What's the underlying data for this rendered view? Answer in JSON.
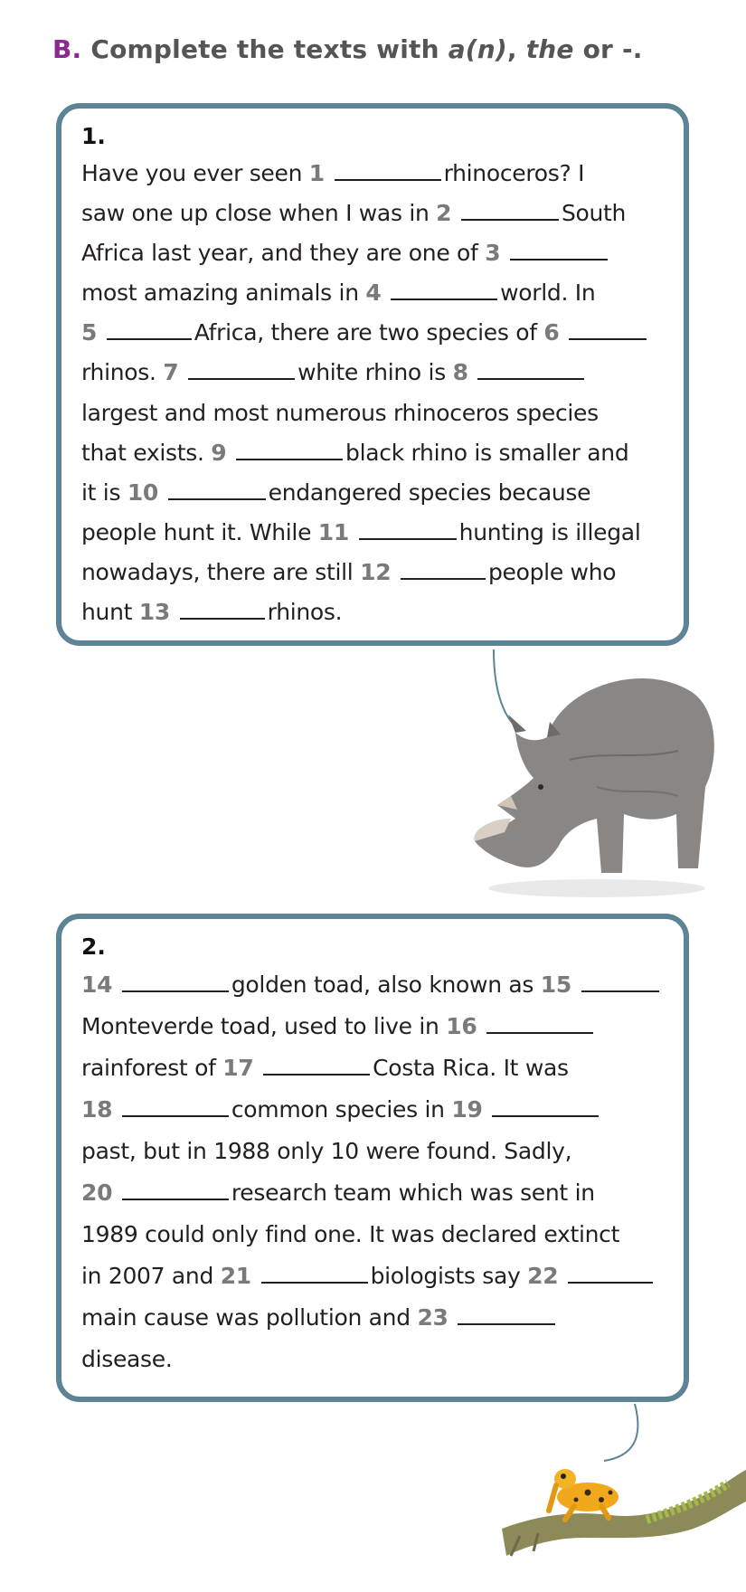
{
  "exercise": {
    "letter": "B.",
    "instruction_pre": "Complete the texts with ",
    "opt1": "a(n)",
    "sep": ", ",
    "opt2": "the",
    "instruction_post": " or -."
  },
  "text1": {
    "number": "1.",
    "lines": [
      [
        {
          "t": "Have you ever seen "
        },
        {
          "n": "1"
        },
        {
          "b": "w90"
        },
        {
          "t": "rhinoceros? I"
        }
      ],
      [
        {
          "t": "saw one up close when I was in "
        },
        {
          "n": "2"
        },
        {
          "b": "w80"
        },
        {
          "t": "South"
        }
      ],
      [
        {
          "t": "Africa last year, and they are one of "
        },
        {
          "n": "3"
        },
        {
          "b": "w80"
        }
      ],
      [
        {
          "t": "most amazing animals in "
        },
        {
          "n": "4"
        },
        {
          "b": "w90"
        },
        {
          "t": "world. In"
        }
      ],
      [
        {
          "n": "5"
        },
        {
          "b": "w70"
        },
        {
          "t": "Africa, there are two species of "
        },
        {
          "n": "6"
        },
        {
          "b": "w60"
        }
      ],
      [
        {
          "t": "rhinos. "
        },
        {
          "n": "7"
        },
        {
          "b": "w90"
        },
        {
          "t": "white rhino is "
        },
        {
          "n": "8"
        },
        {
          "b": "w90"
        }
      ],
      [
        {
          "t": "largest and most numerous rhinoceros species"
        }
      ],
      [
        {
          "t": "that exists. "
        },
        {
          "n": "9"
        },
        {
          "b": "w90"
        },
        {
          "t": "black rhino is smaller and"
        }
      ],
      [
        {
          "t": "it is "
        },
        {
          "n": "10"
        },
        {
          "b": "w80"
        },
        {
          "t": "endangered species because"
        }
      ],
      [
        {
          "t": "people hunt it. While "
        },
        {
          "n": "11"
        },
        {
          "b": "w80"
        },
        {
          "t": "hunting is illegal"
        }
      ],
      [
        {
          "t": "nowadays, there are still "
        },
        {
          "n": "12"
        },
        {
          "b": "w70"
        },
        {
          "t": "people who"
        }
      ],
      [
        {
          "t": "hunt "
        },
        {
          "n": "13"
        },
        {
          "b": "w70"
        },
        {
          "t": "rhinos."
        }
      ]
    ]
  },
  "text2": {
    "number": "2.",
    "lines": [
      [
        {
          "n": "14"
        },
        {
          "b": "w90"
        },
        {
          "t": "golden toad, also known as "
        },
        {
          "n": "15"
        },
        {
          "b": "w60"
        }
      ],
      [
        {
          "t": "Monteverde toad, used to live in "
        },
        {
          "n": "16"
        },
        {
          "b": "w90"
        }
      ],
      [
        {
          "t": "rainforest of "
        },
        {
          "n": "17"
        },
        {
          "b": "w90"
        },
        {
          "t": "Costa Rica. It was"
        }
      ],
      [
        {
          "n": "18"
        },
        {
          "b": "w90"
        },
        {
          "t": "common species in "
        },
        {
          "n": "19"
        },
        {
          "b": "w90"
        }
      ],
      [
        {
          "t": "past, but in 1988 only 10 were found. Sadly,"
        }
      ],
      [
        {
          "n": "20"
        },
        {
          "b": "w90"
        },
        {
          "t": "research team which was sent in"
        }
      ],
      [
        {
          "t": "1989 could only find one. It was declared extinct"
        }
      ],
      [
        {
          "t": "in 2007 and "
        },
        {
          "n": "21"
        },
        {
          "b": "w90"
        },
        {
          "t": "biologists say "
        },
        {
          "n": "22"
        },
        {
          "b": "w70"
        }
      ],
      [
        {
          "t": "main cause was pollution and "
        },
        {
          "n": "23"
        },
        {
          "b": "w80"
        }
      ],
      [
        {
          "t": "disease."
        }
      ]
    ]
  },
  "colors": {
    "accent": "#8a2a8e",
    "box_border": "#5c8396",
    "number_gray": "#7a7a7a"
  },
  "images": [
    "rhinoceros-photo",
    "golden-toad-on-branch-photo"
  ]
}
